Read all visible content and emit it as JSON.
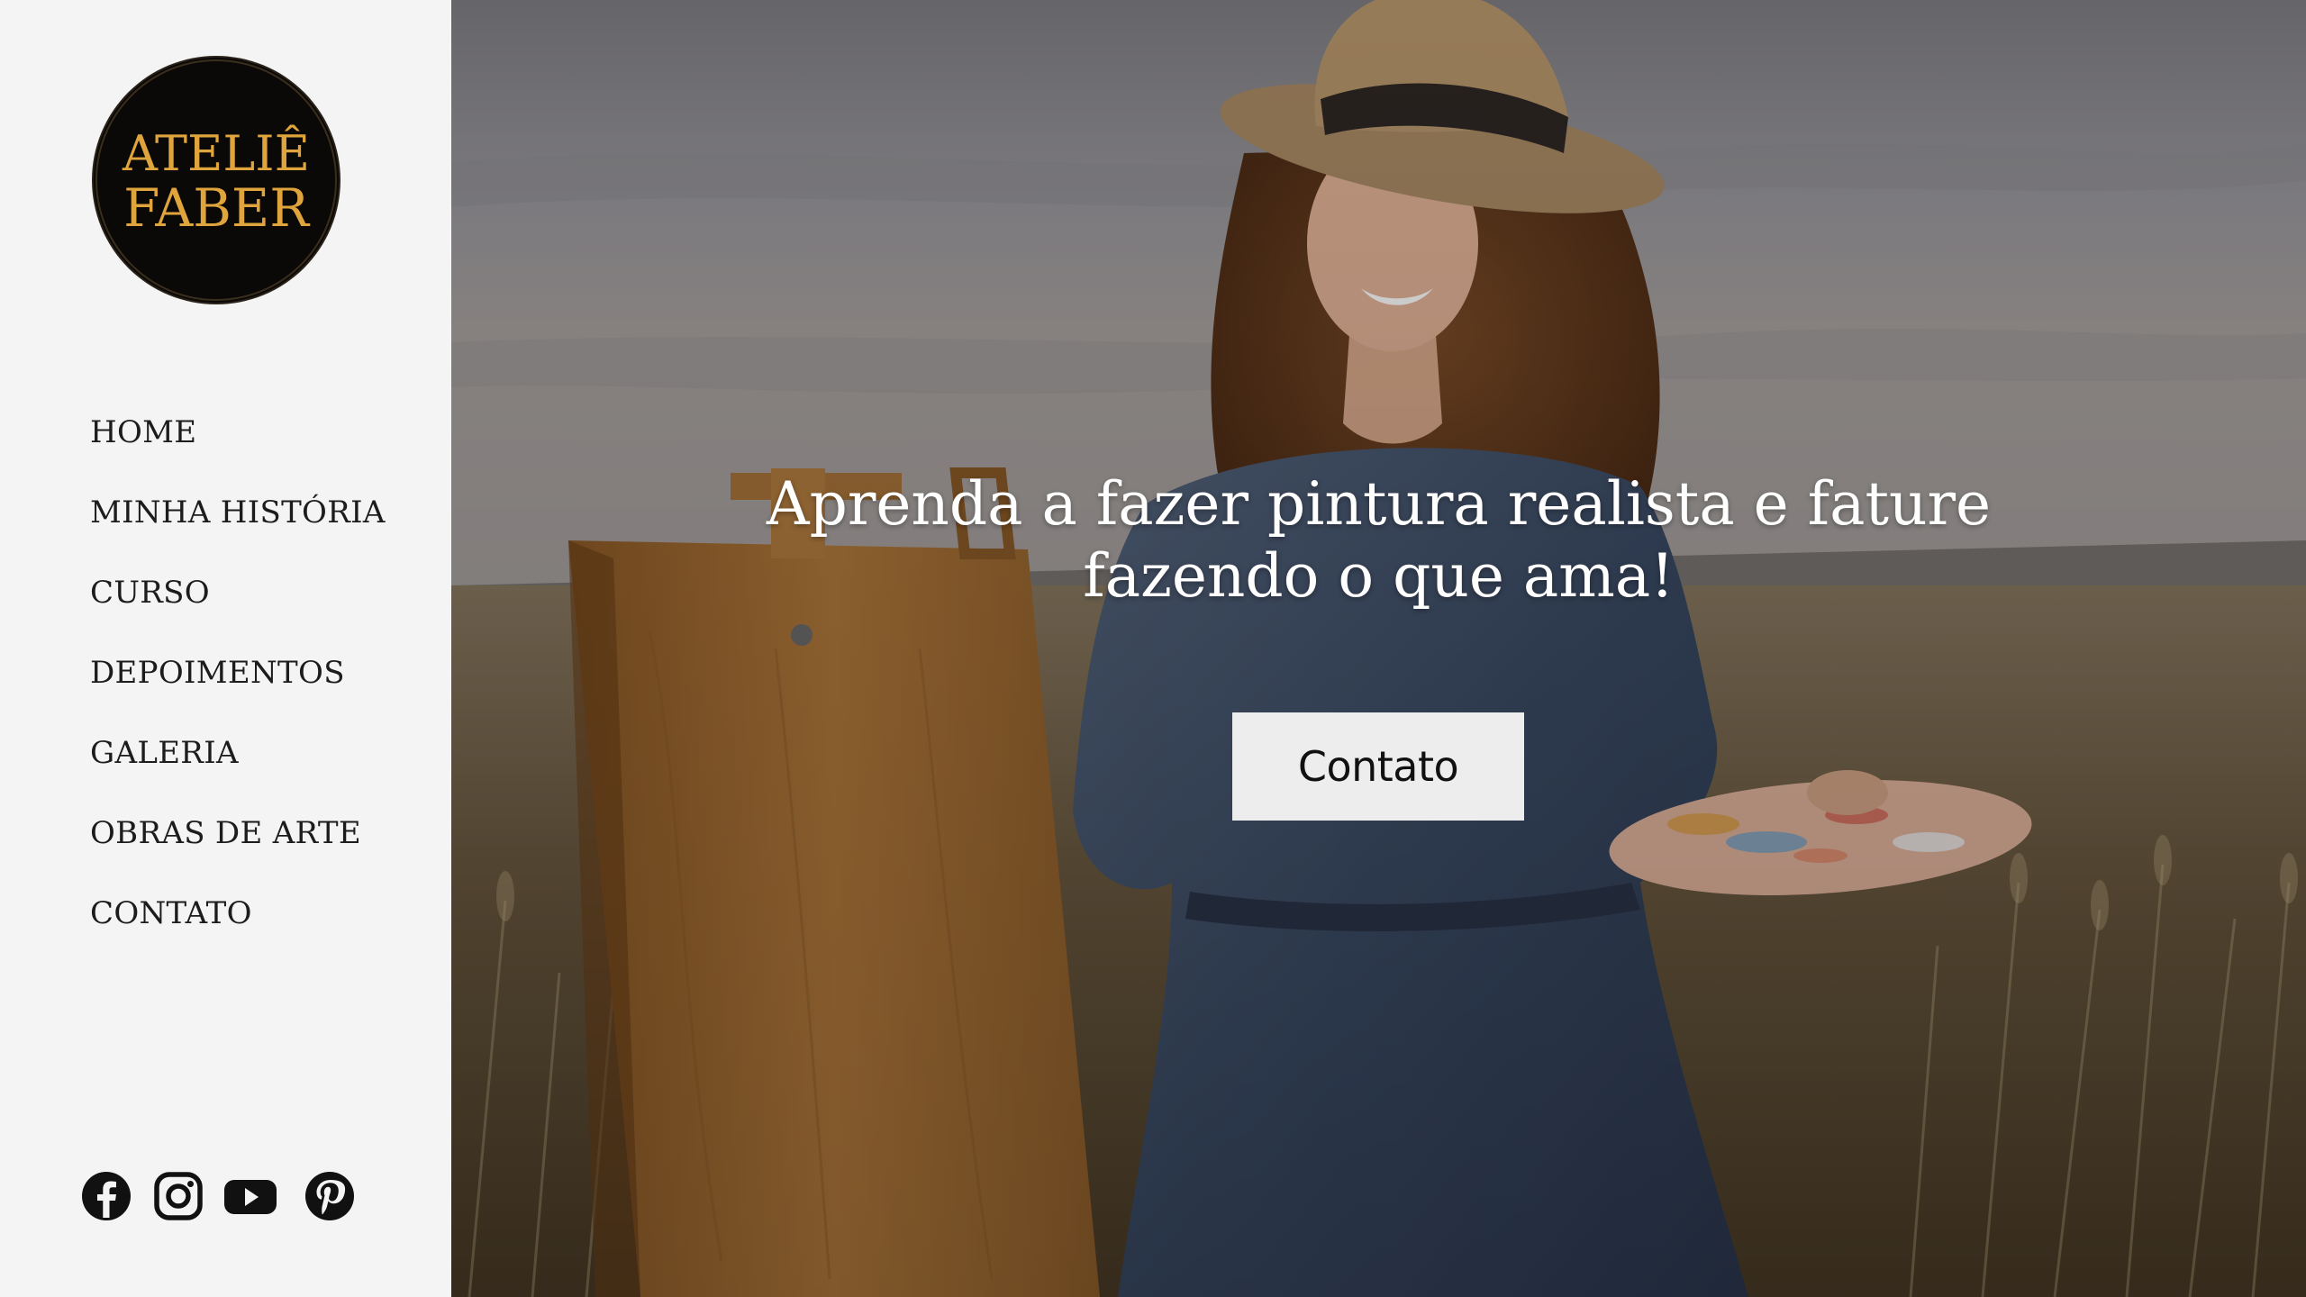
{
  "brand": {
    "logo_line1": "ATELIÊ",
    "logo_line2": "FABER",
    "logo_text_color": "#e0a43c",
    "logo_bg_color": "#0b0907"
  },
  "nav": {
    "items": [
      {
        "label": "HOME"
      },
      {
        "label": "MINHA HISTÓRIA"
      },
      {
        "label": "CURSO"
      },
      {
        "label": "DEPOIMENTOS"
      },
      {
        "label": "GALERIA"
      },
      {
        "label": "OBRAS DE ARTE"
      },
      {
        "label": "CONTATO"
      }
    ]
  },
  "social": [
    {
      "icon": "facebook-icon"
    },
    {
      "icon": "instagram-icon"
    },
    {
      "icon": "youtube-icon"
    },
    {
      "icon": "pinterest-icon"
    }
  ],
  "hero": {
    "headline_line1": "Aprenda a fazer pintura realista e fature",
    "headline_line2": "fazendo o que ama!",
    "cta_label": "Contato",
    "image_subject": "woman-painting-in-wheat-field"
  },
  "colors": {
    "sidebar_bg": "#f4f4f5",
    "nav_text": "#1c1c1c",
    "cta_bg": "#ededed",
    "headline_text": "#ffffff"
  }
}
